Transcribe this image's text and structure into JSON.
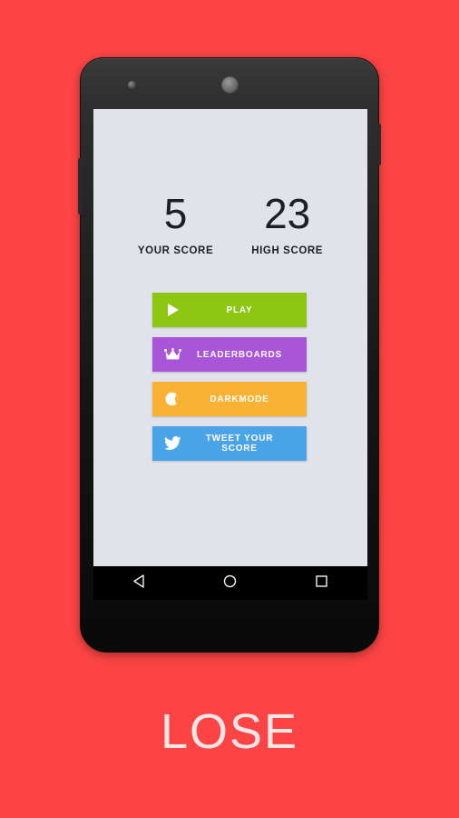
{
  "page": {
    "background_color": "#fc4444",
    "caption": "LOSE"
  },
  "device": {
    "name": "android-phone-mockup",
    "body_color": "#161616",
    "screen_background": "#e0e3e9",
    "hardware": {
      "front_camera": "front-camera",
      "earpiece": "earpiece-speaker",
      "volume_rocker": "volume-rocker",
      "power_button": "power-button"
    }
  },
  "screen": {
    "scores": [
      {
        "value": "5",
        "label": "YOUR SCORE"
      },
      {
        "value": "23",
        "label": "HIGH SCORE"
      }
    ],
    "buttons": [
      {
        "label": "PLAY",
        "icon": "play-icon",
        "color": "#8cc611"
      },
      {
        "label": "LEADERBOARDS",
        "icon": "crown-icon",
        "color": "#a855d8"
      },
      {
        "label": "DARKMODE",
        "icon": "moon-icon",
        "color": "#f9b233"
      },
      {
        "label": "TWEET YOUR SCORE",
        "icon": "twitter-icon",
        "color": "#4ba3e8"
      }
    ],
    "navbar": {
      "background": "#000000",
      "keys": [
        {
          "name": "back-key",
          "icon": "triangle-left-icon"
        },
        {
          "name": "home-key",
          "icon": "circle-icon"
        },
        {
          "name": "recents-key",
          "icon": "square-icon"
        }
      ]
    }
  }
}
